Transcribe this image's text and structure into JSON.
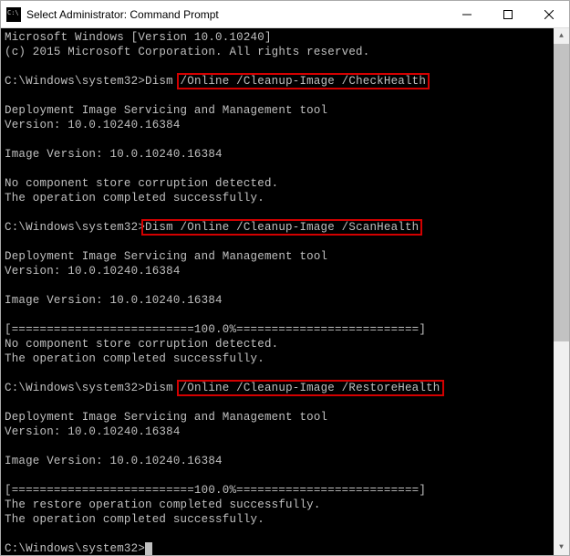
{
  "window": {
    "title": "Select Administrator: Command Prompt"
  },
  "terminal": {
    "line_os": "Microsoft Windows [Version 10.0.10240]",
    "line_copyright": "(c) 2015 Microsoft Corporation. All rights reserved.",
    "prompt1_path": "C:\\Windows\\system32>",
    "cmd1_pre": "Dism ",
    "cmd1_hl": "/Online /Cleanup-Image /CheckHealth",
    "tool_header": "Deployment Image Servicing and Management tool",
    "tool_version": "Version: 10.0.10240.16384",
    "image_version": "Image Version: 10.0.10240.16384",
    "no_corruption": "No component store corruption detected.",
    "op_success": "The operation completed successfully.",
    "prompt2_path": "C:\\Windows\\system32>",
    "cmd2_hl": "Dism /Online /Cleanup-Image /ScanHealth",
    "progress": "[==========================100.0%==========================]",
    "prompt3_path": "C:\\Windows\\system32>",
    "cmd3_pre": "Dism ",
    "cmd3_hl": "/Online /Cleanup-Image /RestoreHealth",
    "restore_success": "The restore operation completed successfully.",
    "prompt_final": "C:\\Windows\\system32>"
  },
  "highlight_color": "#d30000"
}
